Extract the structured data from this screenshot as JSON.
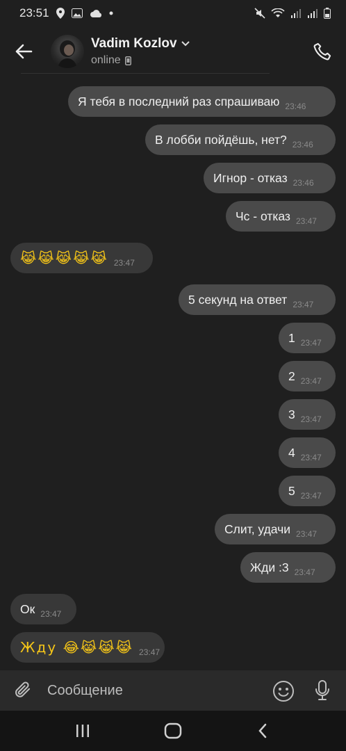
{
  "status_bar": {
    "time": "23:51",
    "left_icons": [
      "location-pin-icon",
      "image-icon",
      "cloud-icon",
      "dot-icon"
    ],
    "right_icons": [
      "mute-icon",
      "wifi-icon",
      "signal-icon",
      "signal-icon",
      "battery-icon"
    ]
  },
  "header": {
    "contact_name": "Vadim Kozlov",
    "status": "online"
  },
  "messages": [
    {
      "dir": "out",
      "text": "Я тебя в последний раз спрашиваю",
      "time": "23:46"
    },
    {
      "dir": "out",
      "text": "В лобби пойдёшь, нет?",
      "time": "23:46"
    },
    {
      "dir": "out",
      "text": "Игнор - отказ",
      "time": "23:46"
    },
    {
      "dir": "out",
      "text": "Чс - отказ",
      "time": "23:47"
    },
    {
      "dir": "in",
      "text": "😹😹😹😹😹",
      "time": "23:47"
    },
    {
      "dir": "out",
      "text": "5 секунд на ответ",
      "time": "23:47"
    },
    {
      "dir": "out",
      "text": "1",
      "time": "23:47"
    },
    {
      "dir": "out",
      "text": "2",
      "time": "23:47"
    },
    {
      "dir": "out",
      "text": "3",
      "time": "23:47"
    },
    {
      "dir": "out",
      "text": "4",
      "time": "23:47"
    },
    {
      "dir": "out",
      "text": "5",
      "time": "23:47"
    },
    {
      "dir": "out",
      "text": "Слит, удачи",
      "time": "23:47"
    },
    {
      "dir": "out",
      "text": "Жди :3",
      "time": "23:47"
    },
    {
      "dir": "in",
      "text": "Ок",
      "time": "23:47"
    },
    {
      "dir": "in",
      "text": "Жду 😂😹😹😹",
      "time": "23:47"
    }
  ],
  "composer": {
    "placeholder": "Сообщение"
  },
  "colors": {
    "background": "#1f1f1f",
    "bubble_out": "#4a4a4a",
    "bubble_in": "#383838",
    "composer": "#2a2a2a",
    "nav": "#141414"
  }
}
